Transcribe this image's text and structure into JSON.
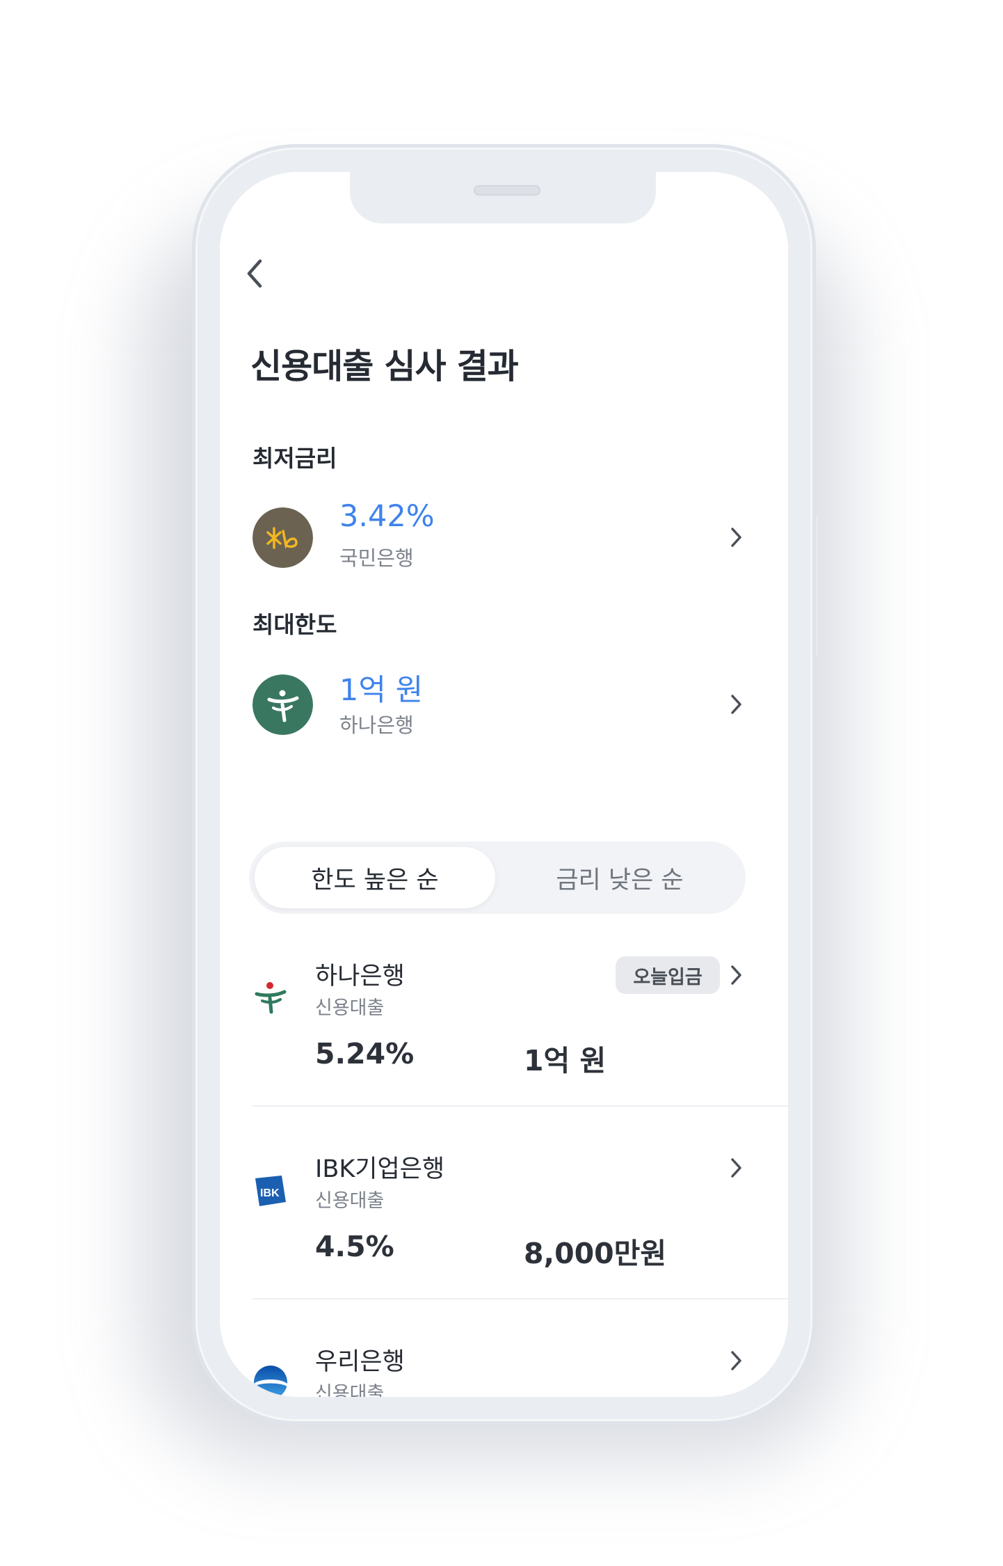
{
  "header": {
    "title": "신용대출 심사 결과"
  },
  "best": {
    "lowest_rate": {
      "label": "최저금리",
      "value": "3.42%",
      "bank": "국민은행"
    },
    "max_limit": {
      "label": "최대한도",
      "value": "1억 원",
      "bank": "하나은행"
    }
  },
  "sort_tabs": [
    {
      "label": "한도 높은 순",
      "selected": true
    },
    {
      "label": "금리 낮은 순",
      "selected": false
    }
  ],
  "loans": [
    {
      "bank": "하나은행",
      "type": "신용대출",
      "rate": "5.24%",
      "limit": "1억 원",
      "badge": "오늘입금"
    },
    {
      "bank": "IBK기업은행",
      "type": "신용대출",
      "rate": "4.5%",
      "limit": "8,000만원"
    },
    {
      "bank": "우리은행",
      "type": "신용대출"
    }
  ],
  "icons": {
    "back": "chevron-left-icon",
    "more": "chevron-right-icon",
    "kb": "kb-bank-logo",
    "hana": "hana-bank-logo",
    "ibk": "ibk-bank-logo",
    "woori": "woori-bank-logo"
  },
  "colors": {
    "accent": "#3f83ec",
    "kb_logo_bg": "#6b6252",
    "hana_logo_bg": "#3a7761",
    "text_primary": "#262b33",
    "text_secondary": "#7c828b"
  }
}
